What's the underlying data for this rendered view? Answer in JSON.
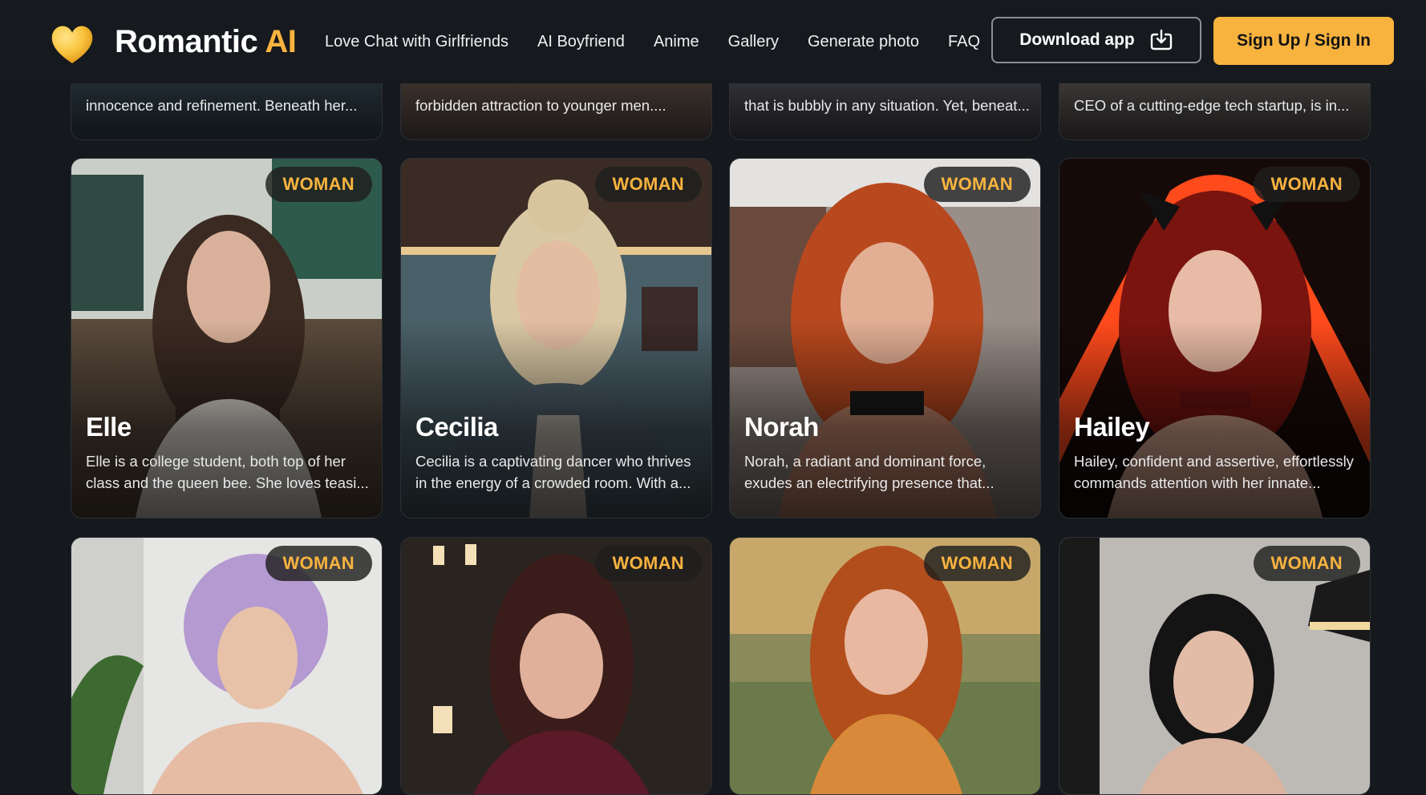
{
  "header": {
    "brand_main": "Romantic",
    "brand_accent": "AI",
    "nav": [
      "Love Chat with Girlfriends",
      "AI Boyfriend",
      "Anime",
      "Gallery",
      "Generate photo",
      "FAQ"
    ],
    "download_label": "Download app",
    "sign_label": "Sign Up / Sign In"
  },
  "colors": {
    "accent": "#f8b33f",
    "background": "#15181c"
  },
  "top_row": [
    {
      "desc": "innocence and refinement. Beneath her..."
    },
    {
      "desc": "forbidden attraction to younger men...."
    },
    {
      "desc": "that is bubbly in any situation. Yet, beneat..."
    },
    {
      "desc": "CEO of a cutting-edge tech startup, is in..."
    }
  ],
  "row2": [
    {
      "badge": "WOMAN",
      "name": "Elle",
      "desc": "Elle is a college student, both top of her class and the queen bee. She loves teasi..."
    },
    {
      "badge": "WOMAN",
      "name": "Cecilia",
      "desc": "Cecilia is a captivating dancer who thrives in the energy of a crowded room. With a..."
    },
    {
      "badge": "WOMAN",
      "name": "Norah",
      "desc": "Norah, a radiant and dominant force, exudes an electrifying presence that..."
    },
    {
      "badge": "WOMAN",
      "name": "Hailey",
      "desc": "Hailey, confident and assertive, effortlessly commands attention with her innate..."
    }
  ],
  "row3": [
    {
      "badge": "WOMAN"
    },
    {
      "badge": "WOMAN"
    },
    {
      "badge": "WOMAN"
    },
    {
      "badge": "WOMAN"
    }
  ]
}
